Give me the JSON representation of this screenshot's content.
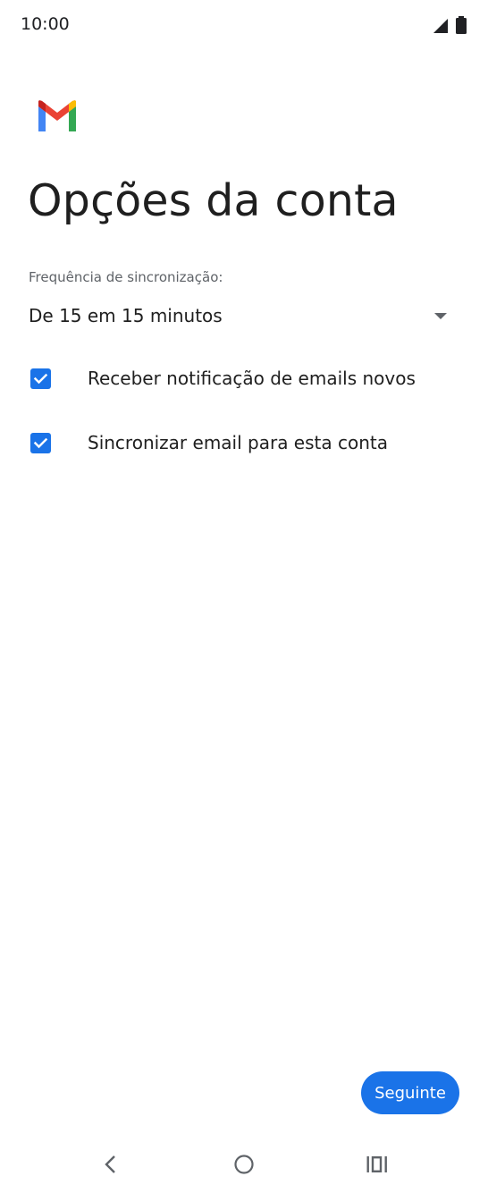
{
  "status_bar": {
    "time": "10:00"
  },
  "app": {
    "logo": "gmail-logo"
  },
  "page": {
    "title": "Opções da conta"
  },
  "sync": {
    "label": "Frequência de sincronização:",
    "value": "De 15 em 15 minutos"
  },
  "options": [
    {
      "label": "Receber notificação de emails novos",
      "checked": true
    },
    {
      "label": "Sincronizar email para esta conta",
      "checked": true
    }
  ],
  "actions": {
    "next_label": "Seguinte"
  },
  "nav": {
    "back_icon": "chevron-left-icon",
    "home_icon": "circle-home-icon",
    "recents_icon": "recents-icon"
  },
  "colors": {
    "accent": "#1a73e8",
    "text_primary": "#1f1f1f",
    "text_secondary": "#5f6368"
  }
}
